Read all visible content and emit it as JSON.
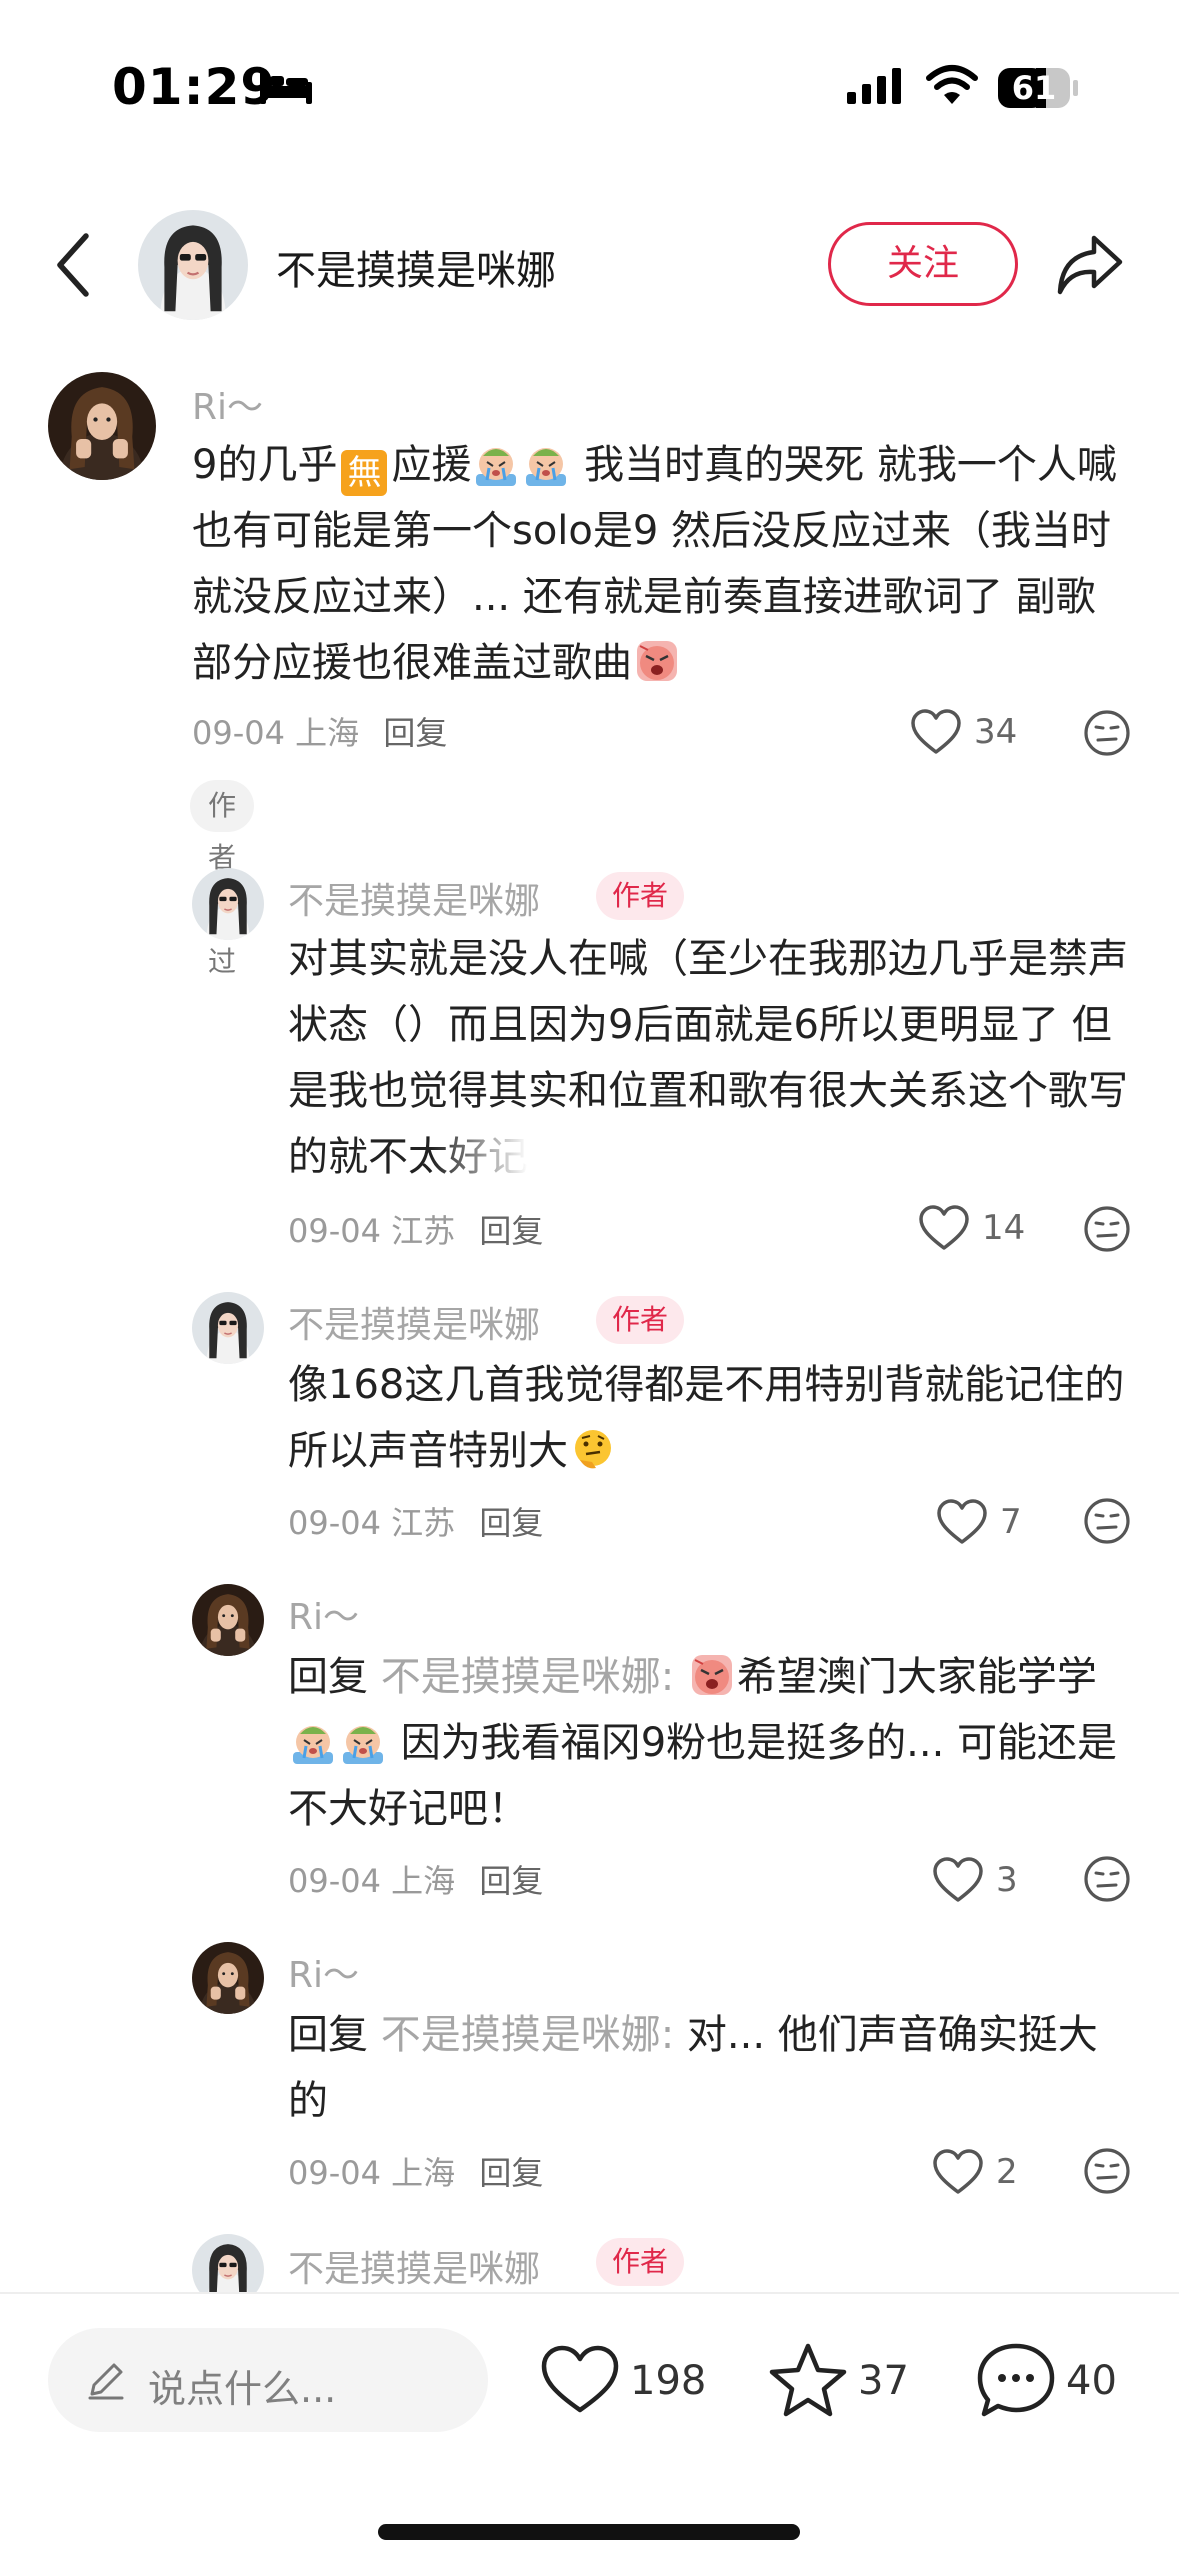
{
  "status_bar": {
    "time": "01:29",
    "battery": "61"
  },
  "header": {
    "title": "不是摸摸是咪娜",
    "follow_label": "关注"
  },
  "comments": [
    {
      "name": "Ri～",
      "text_parts": [
        "9的几乎",
        "無",
        "应援",
        "我当时真的哭死 就我一个人喊 也有可能是第一个solo是9 然后没反应过来（我当时就没反应过来）... 还有就是前奏直接进歌词了 副歌部分应援也很难盖过歌曲"
      ],
      "date": "09-04",
      "location": "上海",
      "reply_label": "回复",
      "likes": "34",
      "tag": "作者赞过"
    },
    {
      "name": "不是摸摸是咪娜",
      "badge": "作者",
      "text_main": "对其实就是没人在喊（至少在我那边几乎是禁声状态（）而且因为9后面就是6所以更明显了 但是我也觉得其实和位置和歌有很大关系这个",
      "text_faded": "歌写的就不太好记",
      "date": "09-04",
      "location": "江苏",
      "reply_label": "回复",
      "likes": "14"
    },
    {
      "name": "不是摸摸是咪娜",
      "badge": "作者",
      "text": "像168这几首我觉得都是不用特别背就能记住的所以声音特别大",
      "date": "09-04",
      "location": "江苏",
      "reply_label": "回复",
      "likes": "7"
    },
    {
      "name": "Ri～",
      "reply_prefix": "回复",
      "reply_to": "不是摸摸是咪娜:",
      "text_a": "希望澳门大家能学学",
      "text_b": "因为我看福冈9粉也是挺多的... 可能还是不大好记吧！",
      "date": "09-04",
      "location": "上海",
      "reply_label": "回复",
      "likes": "3"
    },
    {
      "name": "Ri～",
      "reply_prefix": "回复",
      "reply_to": "不是摸摸是咪娜:",
      "text": "对... 他们声音确实挺大的",
      "date": "09-04",
      "location": "上海",
      "reply_label": "回复",
      "likes": "2"
    },
    {
      "name": "不是摸摸是咪娜",
      "badge": "作者"
    }
  ],
  "bottom_bar": {
    "input_placeholder": "说点什么...",
    "likes": "198",
    "favorites": "37",
    "comments": "40"
  },
  "colors": {
    "accent": "#e0284a",
    "badge_bg": "#fde8ec",
    "muted": "#a6a6a6"
  },
  "icons": [
    "bed-icon",
    "signal-icon",
    "wifi-icon",
    "battery-icon",
    "back-icon",
    "share-icon",
    "heart-icon",
    "dislike-face-icon",
    "pencil-icon",
    "star-icon",
    "comment-bubble-icon"
  ]
}
